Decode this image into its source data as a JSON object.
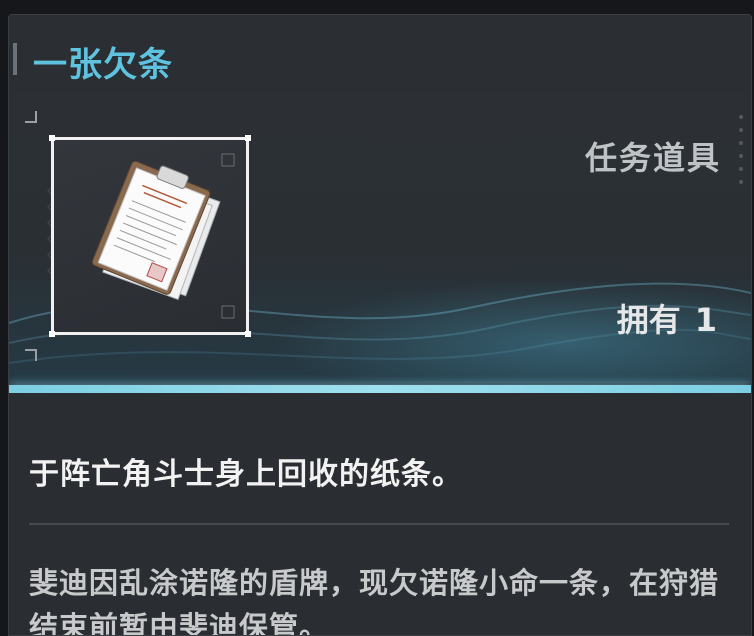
{
  "item": {
    "name": "一张欠条",
    "category": "任务道具",
    "owned_label": "拥有",
    "owned_count": "1",
    "summary": "于阵亡角斗士身上回收的纸条。",
    "description": "斐迪因乱涂诺隆的盾牌，现欠诺隆小命一条，在狩猎结束前暂由斐迪保管。"
  },
  "icons": {
    "item_image": "paper-documents-clipboard-icon"
  },
  "colors": {
    "title": "#5fc3df",
    "accent_line": "#8fdcec"
  }
}
